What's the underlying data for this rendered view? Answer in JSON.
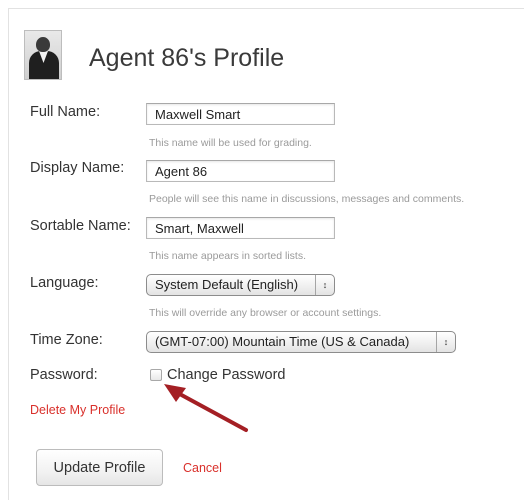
{
  "profile": {
    "title": "Agent 86's Profile",
    "fields": {
      "full_name": {
        "label": "Full Name:",
        "value": "Maxwell Smart",
        "hint": "This name will be used for grading."
      },
      "display_name": {
        "label": "Display Name:",
        "value": "Agent 86",
        "hint": "People will see this name in discussions, messages and comments."
      },
      "sortable_name": {
        "label": "Sortable Name:",
        "value": "Smart, Maxwell",
        "hint": "This name appears in sorted lists."
      },
      "language": {
        "label": "Language:",
        "selected": "System Default (English)",
        "hint": "This will override any browser or account settings."
      },
      "time_zone": {
        "label": "Time Zone:",
        "selected": "(GMT-07:00) Mountain Time (US & Canada)"
      },
      "password": {
        "label": "Password:",
        "checkbox_label": "Change Password",
        "checked": false
      }
    },
    "delete_link": "Delete My Profile",
    "actions": {
      "update_label": "Update Profile",
      "cancel_label": "Cancel"
    }
  },
  "icons": {
    "avatar": "agent-photo",
    "select_arrow": "up-down-chevron-icon",
    "annotation": "red-arrow-icon"
  },
  "colors": {
    "link_red": "#d9302b",
    "annotation_arrow": "#a41f24",
    "hint_gray": "#9a9a9a"
  }
}
